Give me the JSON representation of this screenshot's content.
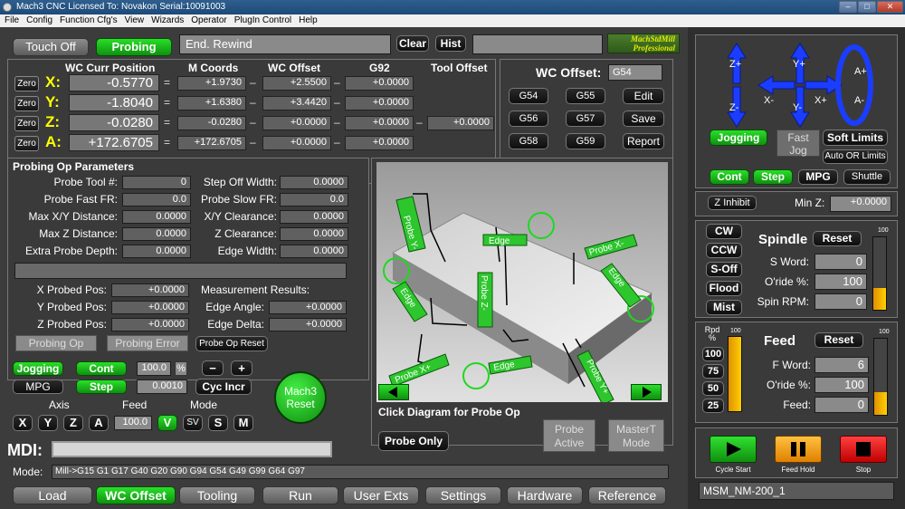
{
  "window": {
    "title": "Mach3 CNC  Licensed To: Novakon Serial:10091003"
  },
  "menu": [
    "File",
    "Config",
    "Function Cfg's",
    "View",
    "Wizards",
    "Operator",
    "PlugIn Control",
    "Help"
  ],
  "top": {
    "touch_off": "Touch Off",
    "probing": "Probing",
    "status_message": "End. Rewind",
    "clear": "Clear",
    "hist": "Hist",
    "brand_line1": "MachStdMill",
    "brand_line2": "Professional"
  },
  "dro": {
    "headers": {
      "wc_curr_position": "WC Curr Position",
      "m_coords": "M Coords",
      "wc_offset": "WC Offset",
      "g92": "G92",
      "tool_offset": "Tool Offset"
    },
    "zero_label": "Zero",
    "rows": [
      {
        "axis": "X:",
        "wc": "-0.5770",
        "m": "+1.9730",
        "off": "+2.5500",
        "g92": "+0.0000"
      },
      {
        "axis": "Y:",
        "wc": "-1.8040",
        "m": "+1.6380",
        "off": "+3.4420",
        "g92": "+0.0000"
      },
      {
        "axis": "Z:",
        "wc": "-0.0280",
        "m": "-0.0280",
        "off": "+0.0000",
        "g92": "+0.0000",
        "tool": "+0.0000"
      },
      {
        "axis": "A:",
        "wc": "+172.6705",
        "m": "+172.6705",
        "off": "+0.0000",
        "g92": "+0.0000"
      }
    ]
  },
  "wcoffset": {
    "label": "WC Offset:",
    "value": "G54",
    "buttons": [
      "G54",
      "G55",
      "Edit",
      "G56",
      "G57",
      "Save",
      "G58",
      "G59",
      "Report"
    ]
  },
  "probe_params": {
    "title": "Probing Op Parameters",
    "left": [
      {
        "label": "Probe Tool #:",
        "value": "0"
      },
      {
        "label": "Probe Fast FR:",
        "value": "0.0"
      },
      {
        "label": "Max X/Y Distance:",
        "value": "0.0000"
      },
      {
        "label": "Max Z Distance:",
        "value": "0.0000"
      },
      {
        "label": "Extra Probe Depth:",
        "value": "0.0000"
      }
    ],
    "right": [
      {
        "label": "Step Off Width:",
        "value": "0.0000"
      },
      {
        "label": "Probe Slow FR:",
        "value": "0.0"
      },
      {
        "label": "X/Y Clearance:",
        "value": "0.0000"
      },
      {
        "label": "Z Clearance:",
        "value": "0.0000"
      },
      {
        "label": "Edge Width:",
        "value": "0.0000"
      }
    ],
    "probed": [
      {
        "label": "X Probed Pos:",
        "value": "+0.0000"
      },
      {
        "label": "Y Probed Pos:",
        "value": "+0.0000"
      },
      {
        "label": "Z Probed Pos:",
        "value": "+0.0000"
      }
    ],
    "results_title": "Measurement Results:",
    "results": [
      {
        "label": "Edge Angle:",
        "value": "+0.0000"
      },
      {
        "label": "Edge Delta:",
        "value": "+0.0000"
      }
    ],
    "probing_op": "Probing Op",
    "probing_error": "Probing Error",
    "probe_op_reset": "Probe Op Reset"
  },
  "diagram": {
    "labels": [
      "Probe Y-",
      "Edge",
      "Probe X-",
      "Edge",
      "Probe Z-",
      "Edge",
      "Probe X+",
      "Edge",
      "Probe Y+"
    ],
    "click_label": "Click Diagram for Probe Op",
    "probe_only": "Probe Only",
    "probe_active": "Probe Active",
    "master_t_mode": "MasterT Mode"
  },
  "jog": {
    "jogging": "Jogging",
    "cont": "Cont",
    "pct": "100.0",
    "pct_sign": "%",
    "minus": "−",
    "plus": "+",
    "mpg": "MPG",
    "step": "Step",
    "step_value": "0.0010",
    "cyc_incr": "Cyc Incr",
    "axis_label": "Axis",
    "feed_label": "Feed",
    "mode_label": "Mode",
    "axes": [
      "X",
      "Y",
      "Z",
      "A"
    ],
    "feed_value": "100.0",
    "modes": [
      "V",
      "SV",
      "S",
      "M"
    ],
    "mach3_reset_line1": "Mach3",
    "mach3_reset_line2": "Reset"
  },
  "mdi": {
    "label": "MDI:",
    "value": ""
  },
  "mode": {
    "label": "Mode:",
    "value": "Mill->G15  G1 G17 G40 G20 G90 G94 G54 G49 G99 G64 G97"
  },
  "tabs": [
    "Load",
    "WC Offset",
    "Tooling",
    "Run",
    "User Exts",
    "Settings",
    "Hardware",
    "Reference"
  ],
  "right": {
    "jog_arrows": [
      "Z+",
      "Y+",
      "X-",
      "X+",
      "Z-",
      "Y-",
      "A+",
      "A-"
    ],
    "jogging": "Jogging",
    "fast_jog": "Fast Jog",
    "soft_limits": "Soft Limits",
    "auto_or_limits": "Auto OR Limits",
    "cont": "Cont",
    "step": "Step",
    "mpg": "MPG",
    "shuttle": "Shuttle",
    "z_inhibit": "Z Inhibit",
    "min_z_label": "Min Z:",
    "min_z_value": "+0.0000",
    "spindle": {
      "cw": "CW",
      "ccw": "CCW",
      "s_off": "S-Off",
      "flood": "Flood",
      "mist": "Mist",
      "title": "Spindle",
      "reset": "Reset",
      "s_word_label": "S Word:",
      "s_word": "0",
      "oride_label": "O'ride %:",
      "oride": "100",
      "rpm_label": "Spin RPM:",
      "rpm": "0",
      "bar_top": "100",
      "bar_level": 0.3
    },
    "rpd": {
      "label": "Rpd %",
      "top": "100",
      "buttons": [
        "100",
        "75",
        "50",
        "25"
      ],
      "bar_level": 1.0
    },
    "feed": {
      "title": "Feed",
      "reset": "Reset",
      "f_word_label": "F Word:",
      "f_word": "6",
      "oride_label": "O'ride %:",
      "oride": "100",
      "feed_label": "Feed:",
      "feed": "0",
      "bar_top": "100",
      "bar_level": 0.3
    },
    "cycle_start": "Cycle Start",
    "feed_hold": "Feed Hold",
    "stop": "Stop",
    "profile": "MSM_NM-200_1"
  },
  "colors": {
    "accent_green": "#1fbf1f",
    "axis_yellow": "#ffff00",
    "led_orange": "#ffb000",
    "stop_red": "#e00000"
  }
}
